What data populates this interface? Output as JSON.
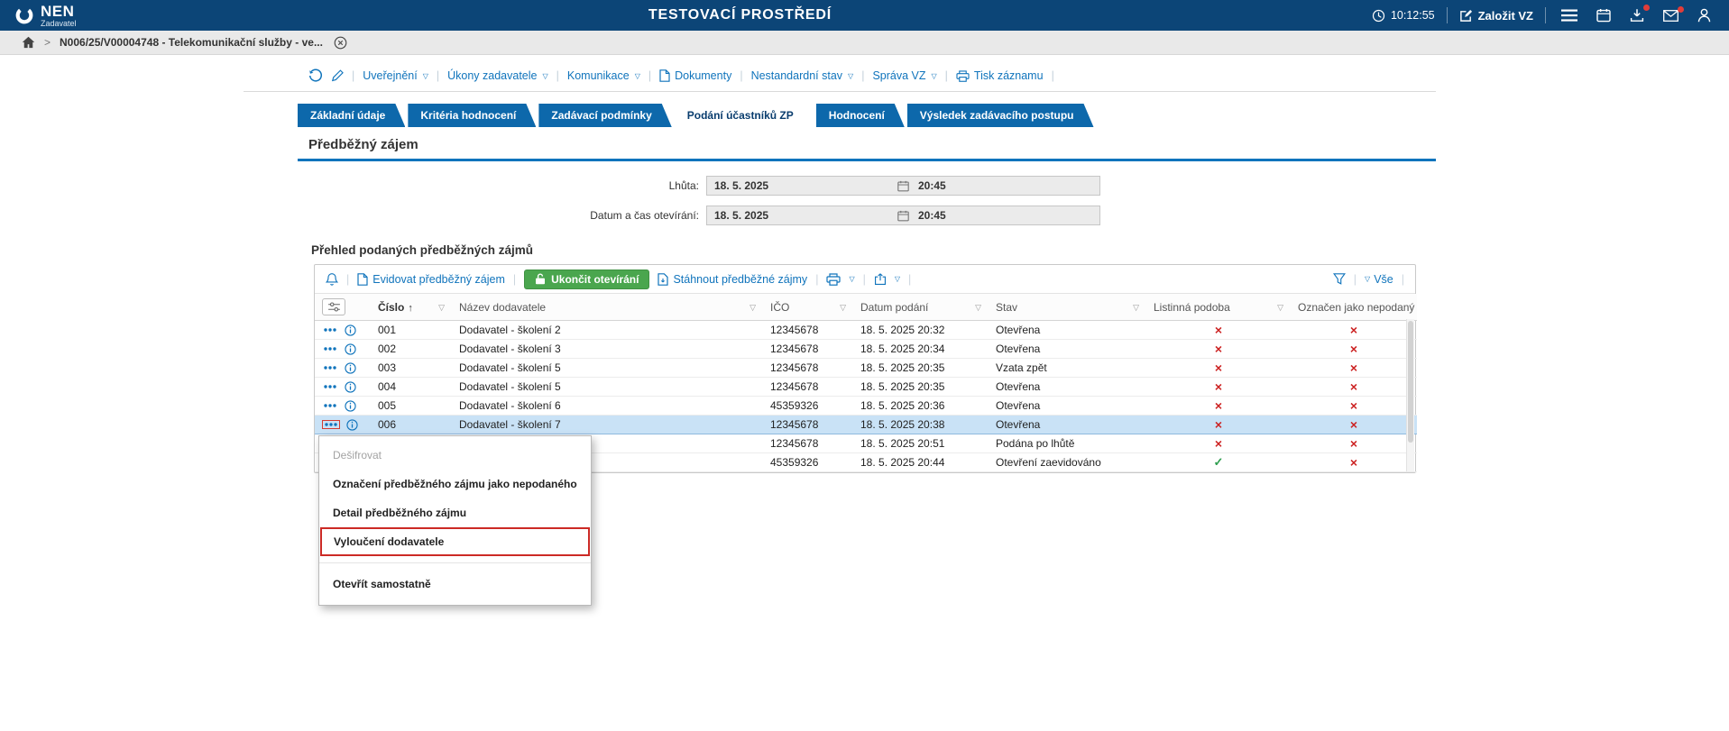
{
  "header": {
    "logo_text": "NEN",
    "logo_subtitle": "Zadavatel",
    "title": "TESTOVACÍ PROSTŘEDÍ",
    "time": "10:12:55",
    "create_vz_label": "Založit VZ"
  },
  "breadcrumb": {
    "item": "N006/25/V00004748 - Telekomunikační služby - ve..."
  },
  "action_bar": {
    "items": [
      {
        "label": "Uveřejnění",
        "dropdown": true,
        "icon": ""
      },
      {
        "label": "Úkony zadavatele",
        "dropdown": true,
        "icon": ""
      },
      {
        "label": "Komunikace",
        "dropdown": true,
        "icon": ""
      },
      {
        "label": "Dokumenty",
        "dropdown": false,
        "icon": "document"
      },
      {
        "label": "Nestandardní stav",
        "dropdown": true,
        "icon": ""
      },
      {
        "label": "Správa VZ",
        "dropdown": true,
        "icon": ""
      },
      {
        "label": "Tisk záznamu",
        "dropdown": false,
        "icon": "printer"
      }
    ]
  },
  "tabs": [
    {
      "label": "Základní údaje",
      "active": false
    },
    {
      "label": "Kritéria hodnocení",
      "active": false
    },
    {
      "label": "Zadávací podmínky",
      "active": false
    },
    {
      "label": "Podání účastníků ZP",
      "active": true
    },
    {
      "label": "Hodnocení",
      "active": false
    },
    {
      "label": "Výsledek zadávacího postupu",
      "active": false
    }
  ],
  "page": {
    "title": "Předběžný zájem"
  },
  "form": {
    "lhuta_label": "Lhůta:",
    "lhuta_date": "18. 5. 2025",
    "lhuta_time": "20:45",
    "otevirani_label": "Datum a čas otevírání:",
    "otevirani_date": "18. 5. 2025",
    "otevirani_time": "20:45"
  },
  "table": {
    "section_title": "Přehled podaných předběžných zájmů",
    "toolbar": {
      "evidovat_label": "Evidovat předběžný zájem",
      "ukoncit_label": "Ukončit otevírání",
      "stahnout_label": "Stáhnout předběžné zájmy",
      "vse_label": "Vše"
    },
    "columns": {
      "cislo": "Číslo",
      "nazev": "Název dodavatele",
      "ico": "IČO",
      "datum": "Datum podání",
      "stav": "Stav",
      "listinna": "Listinná podoba",
      "nepodany": "Označen jako nepodaný"
    },
    "rows": [
      {
        "cislo": "001",
        "nazev": "Dodavatel - školení 2",
        "ico": "12345678",
        "datum": "18. 5. 2025 20:32",
        "stav": "Otevřena",
        "listinna": "cross",
        "nepodany": "cross",
        "selected": false
      },
      {
        "cislo": "002",
        "nazev": "Dodavatel - školení 3",
        "ico": "12345678",
        "datum": "18. 5. 2025 20:34",
        "stav": "Otevřena",
        "listinna": "cross",
        "nepodany": "cross",
        "selected": false
      },
      {
        "cislo": "003",
        "nazev": "Dodavatel - školení 5",
        "ico": "12345678",
        "datum": "18. 5. 2025 20:35",
        "stav": "Vzata zpět",
        "listinna": "cross",
        "nepodany": "cross",
        "selected": false
      },
      {
        "cislo": "004",
        "nazev": "Dodavatel - školení 5",
        "ico": "12345678",
        "datum": "18. 5. 2025 20:35",
        "stav": "Otevřena",
        "listinna": "cross",
        "nepodany": "cross",
        "selected": false
      },
      {
        "cislo": "005",
        "nazev": "Dodavatel - školení 6",
        "ico": "45359326",
        "datum": "18. 5. 2025 20:36",
        "stav": "Otevřena",
        "listinna": "cross",
        "nepodany": "cross",
        "selected": false
      },
      {
        "cislo": "006",
        "nazev": "Dodavatel - školení 7",
        "ico": "12345678",
        "datum": "18. 5. 2025 20:38",
        "stav": "Otevřena",
        "listinna": "cross",
        "nepodany": "cross",
        "selected": true
      },
      {
        "cislo": "",
        "nazev": "",
        "ico": "12345678",
        "datum": "18. 5. 2025 20:51",
        "stav": "Podána po lhůtě",
        "listinna": "cross",
        "nepodany": "cross",
        "selected": false
      },
      {
        "cislo": "",
        "nazev": "",
        "ico": "45359326",
        "datum": "18. 5. 2025 20:44",
        "stav": "Otevření zaevidováno",
        "listinna": "check",
        "nepodany": "cross",
        "selected": false
      }
    ]
  },
  "context_menu": {
    "items": [
      {
        "label": "Dešifrovat",
        "state": "disabled",
        "separator_before": false
      },
      {
        "label": "Označení předběžného zájmu jako nepodaného",
        "state": "normal",
        "separator_before": false
      },
      {
        "label": "Detail předběžného zájmu",
        "state": "normal",
        "separator_before": false
      },
      {
        "label": "Vyloučení dodavatele",
        "state": "highlighted",
        "separator_before": false
      },
      {
        "label": "Otevřít samostatně",
        "state": "normal",
        "separator_before": true
      }
    ]
  }
}
